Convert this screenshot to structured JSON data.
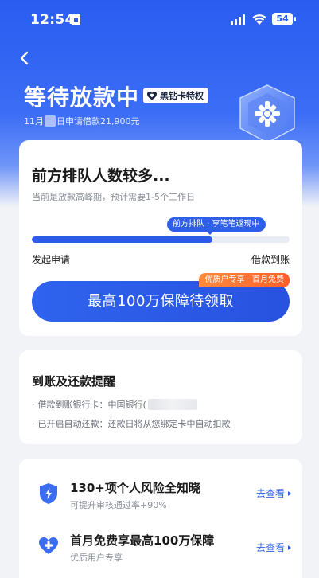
{
  "status_bar": {
    "time": "12:54",
    "battery": "54"
  },
  "header": {
    "title": "等待放款中",
    "badge_label": "黑钻卡特权",
    "apply_prefix": "11月",
    "apply_suffix": "日申请借款21,900元"
  },
  "main_card": {
    "title": "前方排队人数较多...",
    "subtitle": "当前是放款高峰期，预计需要1-5个工作日",
    "progress_tip": "前方排队 · 享笔笔返现中",
    "progress_fraction": 0.7,
    "progress_start": "发起申请",
    "progress_end": "借款到账",
    "promo_tag": "优质户专享 · 首月免费",
    "cta_label": "最高100万保障待领取"
  },
  "reminder": {
    "title": "到账及还款提醒",
    "lines": [
      "借款到账银行卡：中国银行(",
      "已开启自动还款：还款日将从您绑定卡中自动扣款"
    ]
  },
  "features": [
    {
      "icon": "shield-bolt-icon",
      "title": "130+项个人风险全知晓",
      "subtitle": "可提升审核通过率+90%",
      "link": "去查看"
    },
    {
      "icon": "heart-plus-icon",
      "title": "首月免费享最高100万保障",
      "subtitle": "优质用户专享",
      "link": "去查看"
    }
  ],
  "colors": {
    "brand_blue": "#2a5ce8",
    "promo_orange": "#ff6a2f"
  }
}
